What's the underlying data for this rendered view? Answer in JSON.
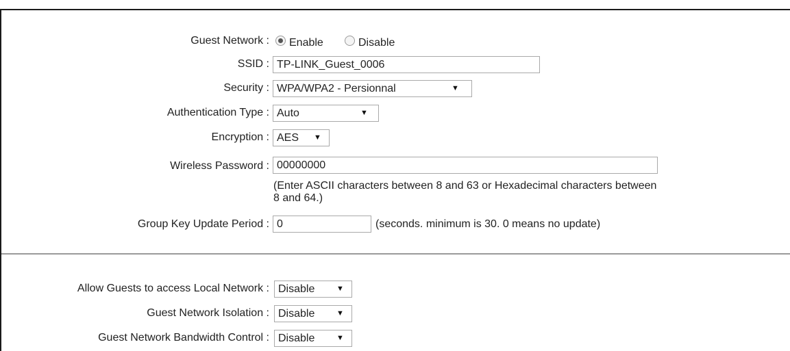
{
  "guest_network": {
    "label": "Guest Network :",
    "options": [
      {
        "label": "Enable",
        "checked": true
      },
      {
        "label": "Disable",
        "checked": false
      }
    ]
  },
  "ssid": {
    "label": "SSID :",
    "value": "TP-LINK_Guest_0006"
  },
  "security": {
    "label": "Security :",
    "selected": "WPA/WPA2 - Persionnal"
  },
  "auth_type": {
    "label": "Authentication Type :",
    "selected": "Auto"
  },
  "encryption": {
    "label": "Encryption :",
    "selected": "AES"
  },
  "wireless_password": {
    "label": "Wireless Password :",
    "value": "00000000",
    "hint_line1": "(Enter ASCII characters between 8 and 63 or Hexadecimal characters between",
    "hint_line2": "8 and 64.)"
  },
  "group_key": {
    "label": "Group Key Update Period :",
    "value": "0",
    "hint": "(seconds. minimum is 30. 0 means no update)"
  },
  "allow_local": {
    "label": "Allow Guests to access Local Network :",
    "selected": "Disable"
  },
  "isolation": {
    "label": "Guest Network Isolation :",
    "selected": "Disable"
  },
  "bandwidth": {
    "label": "Guest Network Bandwidth Control :",
    "selected": "Disable"
  },
  "arrow_glyph": "▼"
}
